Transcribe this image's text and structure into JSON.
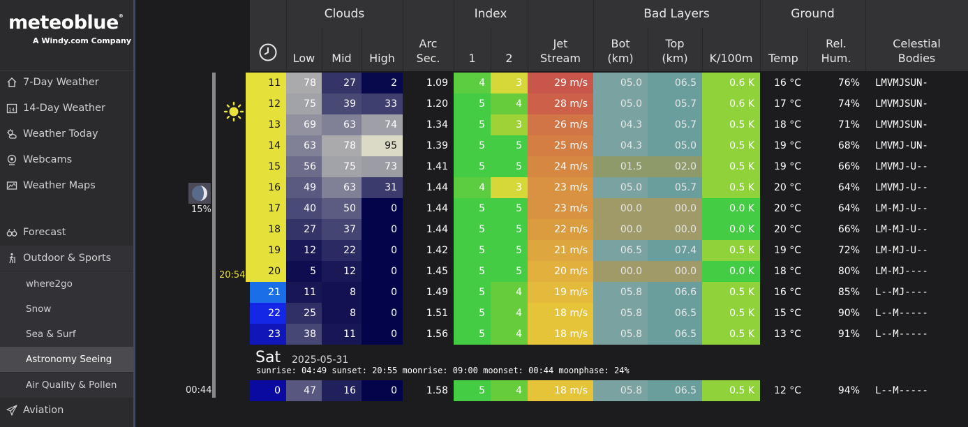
{
  "brand": {
    "name": "meteoblue",
    "mark": "®",
    "tagline": "A Windy.com Company"
  },
  "nav": [
    {
      "label": "7-Day Weather",
      "icon": "home-icon"
    },
    {
      "label": "14-Day Weather",
      "icon": "calendar-14-icon"
    },
    {
      "label": "Weather Today",
      "icon": "sun-cloud-icon"
    },
    {
      "label": "Webcams",
      "icon": "webcam-icon"
    },
    {
      "label": "Weather Maps",
      "icon": "map-icon"
    },
    {
      "label": "Forecast",
      "icon": "binoculars-icon"
    },
    {
      "label": "Outdoor & Sports",
      "icon": "hiker-icon"
    },
    {
      "label": "where2go"
    },
    {
      "label": "Snow"
    },
    {
      "label": "Sea & Surf"
    },
    {
      "label": "Astronomy Seeing"
    },
    {
      "label": "Air Quality & Pollen"
    },
    {
      "label": "Aviation",
      "icon": "plane-icon"
    }
  ],
  "gutter": {
    "moon_pct": "15%",
    "sunset_time": "20:54",
    "moonset_time": "00:44",
    "sun_icon": "sun-icon",
    "moon_icon": "moon-phase-icon"
  },
  "table": {
    "groups": {
      "clouds": "Clouds",
      "index": "Index",
      "bad_layers": "Bad Layers",
      "ground": "Ground"
    },
    "columns": {
      "time_icon": "clock-icon",
      "low": "Low",
      "mid": "Mid",
      "high": "High",
      "arc_sec": "Arc\nSec.",
      "idx1": "1",
      "idx2": "2",
      "jet": "Jet\nStream",
      "bot": "Bot\n(km)",
      "top": "Top\n(km)",
      "k100": "K/100m",
      "temp": "Temp",
      "rh": "Rel.\nHum.",
      "celestial": "Celestial\nBodies"
    },
    "rows_day1": [
      {
        "hour": "11",
        "low": "78",
        "mid": "27",
        "high": "2",
        "arc": "1.09",
        "i1": "4",
        "i2": "3",
        "jet": "29 m/s",
        "bot": "05.0",
        "top": "06.5",
        "k": "0.6 K",
        "temp": "16 °C",
        "rh": "76%",
        "cel": "LMVMJSUN-"
      },
      {
        "hour": "12",
        "low": "75",
        "mid": "39",
        "high": "33",
        "arc": "1.20",
        "i1": "5",
        "i2": "4",
        "jet": "28 m/s",
        "bot": "05.0",
        "top": "05.7",
        "k": "0.6 K",
        "temp": "17 °C",
        "rh": "74%",
        "cel": "LMVMJSUN-"
      },
      {
        "hour": "13",
        "low": "69",
        "mid": "63",
        "high": "74",
        "arc": "1.34",
        "i1": "5",
        "i2": "3",
        "jet": "26 m/s",
        "bot": "04.3",
        "top": "05.7",
        "k": "0.5 K",
        "temp": "18 °C",
        "rh": "71%",
        "cel": "LMVMJSUN-"
      },
      {
        "hour": "14",
        "low": "63",
        "mid": "78",
        "high": "95",
        "arc": "1.39",
        "i1": "5",
        "i2": "5",
        "jet": "25 m/s",
        "bot": "04.3",
        "top": "05.0",
        "k": "0.5 K",
        "temp": "19 °C",
        "rh": "68%",
        "cel": "LMVMJ-UN-"
      },
      {
        "hour": "15",
        "low": "56",
        "mid": "75",
        "high": "73",
        "arc": "1.41",
        "i1": "5",
        "i2": "5",
        "jet": "24 m/s",
        "bot": "01.5",
        "top": "02.0",
        "k": "0.5 K",
        "temp": "19 °C",
        "rh": "66%",
        "cel": "LMVMJ-U--"
      },
      {
        "hour": "16",
        "low": "49",
        "mid": "63",
        "high": "31",
        "arc": "1.44",
        "i1": "4",
        "i2": "3",
        "jet": "23 m/s",
        "bot": "05.0",
        "top": "05.7",
        "k": "0.5 K",
        "temp": "20 °C",
        "rh": "64%",
        "cel": "LMVMJ-U--"
      },
      {
        "hour": "17",
        "low": "40",
        "mid": "50",
        "high": "0",
        "arc": "1.44",
        "i1": "5",
        "i2": "5",
        "jet": "23 m/s",
        "bot": "00.0",
        "top": "00.0",
        "k": "0.0 K",
        "temp": "20 °C",
        "rh": "64%",
        "cel": "LM-MJ-U--"
      },
      {
        "hour": "18",
        "low": "27",
        "mid": "37",
        "high": "0",
        "arc": "1.44",
        "i1": "5",
        "i2": "5",
        "jet": "22 m/s",
        "bot": "00.0",
        "top": "00.0",
        "k": "0.0 K",
        "temp": "20 °C",
        "rh": "66%",
        "cel": "LM-MJ-U--"
      },
      {
        "hour": "19",
        "low": "12",
        "mid": "22",
        "high": "0",
        "arc": "1.42",
        "i1": "5",
        "i2": "5",
        "jet": "21 m/s",
        "bot": "06.5",
        "top": "07.4",
        "k": "0.5 K",
        "temp": "19 °C",
        "rh": "72%",
        "cel": "LM-MJ-U--"
      },
      {
        "hour": "20",
        "low": "5",
        "mid": "12",
        "high": "0",
        "arc": "1.45",
        "i1": "5",
        "i2": "5",
        "jet": "20 m/s",
        "bot": "00.0",
        "top": "00.0",
        "k": "0.0 K",
        "temp": "18 °C",
        "rh": "80%",
        "cel": "LM-MJ----"
      },
      {
        "hour": "21",
        "low": "11",
        "mid": "8",
        "high": "0",
        "arc": "1.49",
        "i1": "5",
        "i2": "4",
        "jet": "19 m/s",
        "bot": "05.8",
        "top": "06.6",
        "k": "0.5 K",
        "temp": "16 °C",
        "rh": "85%",
        "cel": "L--MJ----"
      },
      {
        "hour": "22",
        "low": "25",
        "mid": "8",
        "high": "0",
        "arc": "1.51",
        "i1": "5",
        "i2": "4",
        "jet": "18 m/s",
        "bot": "05.8",
        "top": "06.5",
        "k": "0.5 K",
        "temp": "15 °C",
        "rh": "90%",
        "cel": "L--M-----"
      },
      {
        "hour": "23",
        "low": "38",
        "mid": "11",
        "high": "0",
        "arc": "1.56",
        "i1": "5",
        "i2": "4",
        "jet": "18 m/s",
        "bot": "05.8",
        "top": "06.5",
        "k": "0.5 K",
        "temp": "13 °C",
        "rh": "91%",
        "cel": "L--M-----"
      }
    ],
    "day2": {
      "day": "Sat",
      "date": "2025-05-31",
      "info": "sunrise: 04:49 sunset: 20:55 moonrise: 09:00 moonset: 00:44 moonphase: 24%"
    },
    "rows_day2": [
      {
        "hour": "0",
        "low": "47",
        "mid": "16",
        "high": "0",
        "arc": "1.58",
        "i1": "5",
        "i2": "4",
        "jet": "18 m/s",
        "bot": "05.8",
        "top": "06.5",
        "k": "0.5 K",
        "temp": "12 °C",
        "rh": "94%",
        "cel": "L--M-----"
      }
    ]
  },
  "colors": {
    "day_yellow": "#e5e13a",
    "night_blue": "#1565e0",
    "index_green": "#44cc44",
    "jet_red": "#cc5a4a",
    "k_green": "#8fd23a"
  }
}
